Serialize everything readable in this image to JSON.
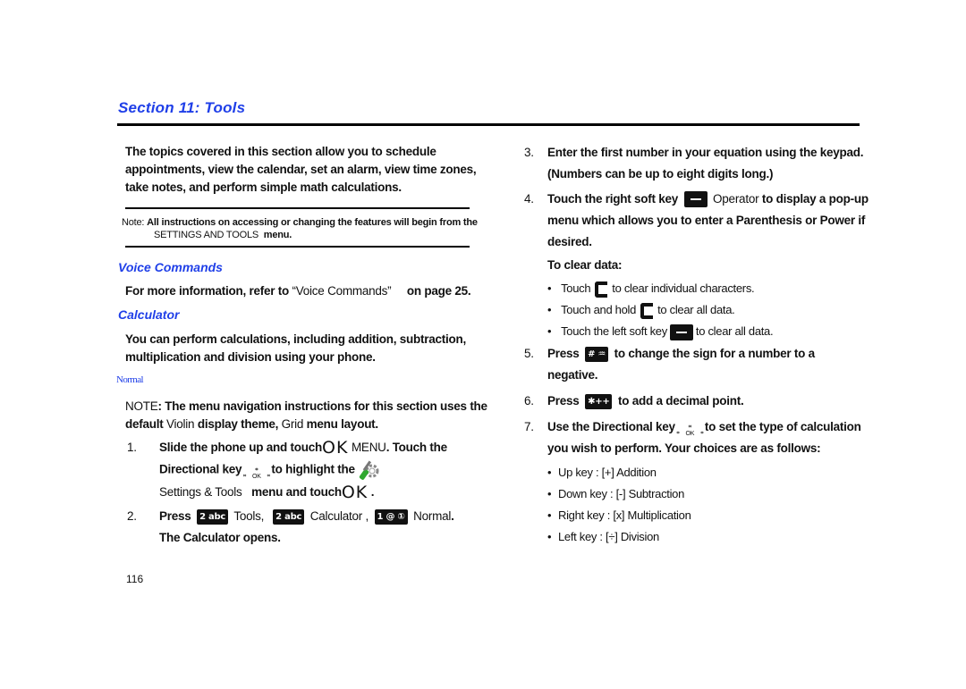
{
  "header": {
    "section_title": "Section 11: Tools"
  },
  "intro": {
    "text": "The topics covered in this section allow you to schedule appointments, view the calendar, set an alarm, view time zones, take notes, and perform simple math calculations."
  },
  "note_box": {
    "label": "Note:",
    "text_a": "All instructions on accessing or changing the features will begin from the",
    "menu_name": "SETTINGS AND TOOLS",
    "text_b": "menu."
  },
  "voice_commands": {
    "heading": "Voice Commands",
    "text_a": "For more information, refer to",
    "ref": "“Voice Commands”",
    "text_b": "on page 25."
  },
  "calculator": {
    "heading": "Calculator",
    "intro": "You can perform calculations, including addition, subtraction, multiplication and division using your phone.",
    "subheading": "Normal",
    "nav_note": {
      "label": "NOTE",
      "text_a": ": The menu navigation instructions for this section uses the default",
      "theme": "Violin",
      "text_b": "display theme,",
      "layout": "Grid",
      "text_c": "menu layout."
    },
    "steps_left": [
      {
        "num": "1.",
        "line1_a": "Slide the phone up and touch",
        "ok": "OK",
        "menu": "MENU",
        "line1_b": ". Touch the",
        "line2_a": "Directional key",
        "line2_b": "to highlight the",
        "line3_a": "Settings & Tools",
        "line3_b": "menu and touch",
        "line3_end": "."
      },
      {
        "num": "2.",
        "press": "Press",
        "key1": "2 abc",
        "item1": "Tools,",
        "key2": "2 abc",
        "item2": "Calculator ,",
        "key3": "1 @ ①",
        "item3": "Normal",
        "end": ".",
        "line2": "The Calculator opens."
      }
    ],
    "steps_right": {
      "step3": {
        "num": "3.",
        "text": "Enter the first number in your equation using the keypad. (Numbers can be up to eight digits long.)"
      },
      "step4": {
        "num": "4.",
        "text_a": "Touch the right soft key",
        "label": "Operator",
        "text_b": "to display a pop-up menu which allows you to enter a Parenthesis or Power if desired."
      },
      "clear_heading": "To clear data:",
      "clear_items": [
        {
          "a": "Touch",
          "b": "to clear individual characters."
        },
        {
          "a": "Touch and hold",
          "b": "to clear all data."
        },
        {
          "a": "Touch the left soft key",
          "b": "to clear all data."
        }
      ],
      "step5": {
        "num": "5.",
        "press": "Press",
        "key": "# ♒",
        "text": "to change the sign for a number to a negative."
      },
      "step6": {
        "num": "6.",
        "press": "Press",
        "key": "✱++",
        "text": "to add a decimal point."
      },
      "step7": {
        "num": "7.",
        "text_a": "Use the Directional key",
        "text_b": "to set the type of calculation you wish to perform. Your choices are as follows:"
      },
      "choices": [
        "Up key : [+] Addition",
        "Down key : [-] Subtraction",
        "Right key : [x] Multiplication",
        "Left key : [÷] Division"
      ]
    }
  },
  "dirkey": {
    "center": "OK",
    "mark": "⌗"
  },
  "footer": {
    "page_number": "116"
  }
}
